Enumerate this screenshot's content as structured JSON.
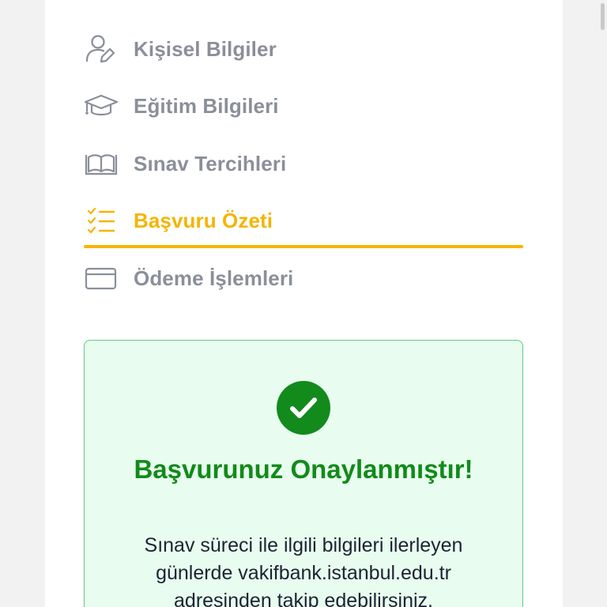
{
  "steps": [
    {
      "label": "Kişisel Bilgiler",
      "icon": "user-edit-icon",
      "active": false
    },
    {
      "label": "Eğitim Bilgileri",
      "icon": "graduation-cap-icon",
      "active": false
    },
    {
      "label": "Sınav Tercihleri",
      "icon": "open-book-icon",
      "active": false
    },
    {
      "label": "Başvuru Özeti",
      "icon": "checklist-icon",
      "active": true
    },
    {
      "label": "Ödeme İşlemleri",
      "icon": "credit-card-icon",
      "active": false
    }
  ],
  "colors": {
    "inactive": "#8a8f99",
    "active": "#f5b400",
    "success": "#138a1a",
    "success_bg": "#e8fdf0",
    "success_border": "#5ecb84"
  },
  "success": {
    "icon": "check-circle-icon",
    "title": "Başvurunuz Onaylanmıştır!",
    "message": "Sınav süreci ile ilgili bilgileri ilerleyen günlerde vakifbank.istanbul.edu.tr adresinden takip edebilirsiniz."
  }
}
